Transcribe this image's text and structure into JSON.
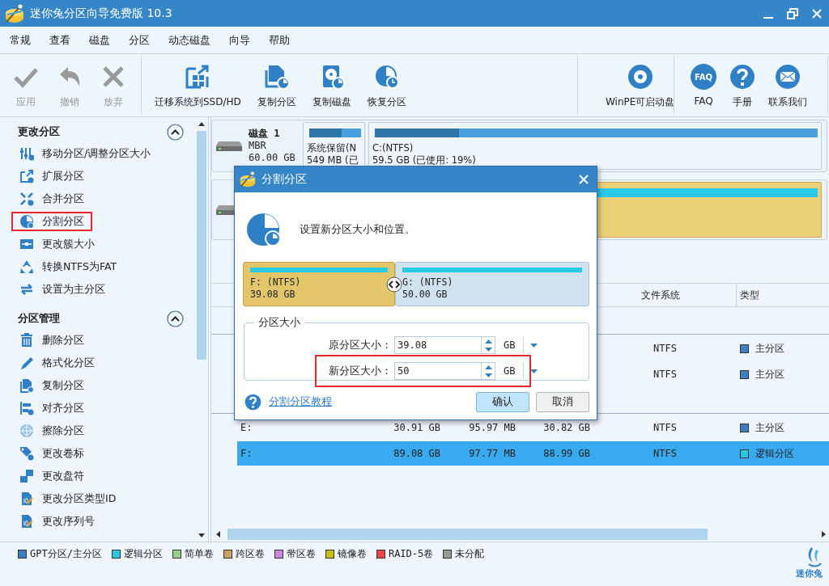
{
  "window": {
    "title": "迷你兔分区向导免费版 10.3"
  },
  "menu": [
    "常规",
    "查看",
    "磁盘",
    "分区",
    "动态磁盘",
    "向导",
    "帮助"
  ],
  "toolbar": {
    "groups": [
      {
        "buttons": [
          {
            "label": "应用",
            "disabled": true
          },
          {
            "label": "撤销",
            "disabled": true
          },
          {
            "label": "放弃",
            "disabled": true
          }
        ]
      },
      {
        "buttons": [
          {
            "label": "迁移系统到SSD/HD",
            "disabled": false
          },
          {
            "label": "复制分区",
            "disabled": false
          },
          {
            "label": "复制磁盘",
            "disabled": false
          },
          {
            "label": "恢复分区",
            "disabled": false
          }
        ]
      },
      {
        "buttons": [
          {
            "label": "WinPE可启动盘",
            "disabled": false
          }
        ]
      },
      {
        "buttons": [
          {
            "label": "FAQ",
            "badge": "FAQ",
            "disabled": false
          },
          {
            "label": "手册",
            "disabled": false
          },
          {
            "label": "联系我们",
            "disabled": false
          }
        ]
      }
    ]
  },
  "sidebar": {
    "sections": [
      {
        "title": "更改分区",
        "expanded": true,
        "items": [
          {
            "label": "移动分区/调整分区大小",
            "highlighted": false
          },
          {
            "label": "扩展分区",
            "highlighted": false
          },
          {
            "label": "合并分区",
            "highlighted": false
          },
          {
            "label": "分割分区",
            "highlighted": true
          },
          {
            "label": "更改簇大小",
            "highlighted": false
          },
          {
            "label": "转换NTFS为FAT",
            "highlighted": false
          },
          {
            "label": "设置为主分区",
            "highlighted": false
          }
        ]
      },
      {
        "title": "分区管理",
        "expanded": true,
        "items": [
          {
            "label": "删除分区",
            "highlighted": false
          },
          {
            "label": "格式化分区",
            "highlighted": false
          },
          {
            "label": "复制分区",
            "highlighted": false
          },
          {
            "label": "对齐分区",
            "highlighted": false
          },
          {
            "label": "擦除分区",
            "highlighted": false
          },
          {
            "label": "更改卷标",
            "highlighted": false
          },
          {
            "label": "更改盘符",
            "highlighted": false
          },
          {
            "label": "更改分区类型ID",
            "highlighted": false
          },
          {
            "label": "更改序列号",
            "highlighted": false
          }
        ]
      }
    ]
  },
  "disk_map": {
    "disks": [
      {
        "name": "磁盘 1",
        "scheme": "MBR",
        "size": "60.00 GB",
        "partitions": [
          {
            "kind": "primary",
            "label": "系统保留(N",
            "detail": "549 MB (已",
            "level": 0.62,
            "selected": false
          },
          {
            "kind": "primary",
            "label": "C:(NTFS)",
            "detail": "59.5 GB (已使用: 19%)",
            "level": 0.19,
            "selected": false
          }
        ]
      },
      {
        "partitions": [
          {
            "kind": "logical",
            "selected": true
          }
        ]
      }
    ]
  },
  "table": {
    "columns": [
      "文件系统",
      "类型"
    ],
    "groups": [
      {
        "rows": [
          {
            "file_system": "NTFS",
            "type": "主分区",
            "color": "#3a7fc1",
            "selected": false
          },
          {
            "file_system": "NTFS",
            "type": "主分区",
            "color": "#3a7fc1",
            "selected": false
          }
        ]
      },
      {
        "rows": [
          {
            "partition": "E:",
            "capacity": "30.91 GB",
            "used": "95.97 MB",
            "unused": "30.82 GB",
            "file_system": "NTFS",
            "type": "主分区",
            "color": "#3a7fc1",
            "selected": false
          },
          {
            "partition": "F:",
            "capacity": "89.08 GB",
            "used": "97.77 MB",
            "unused": "88.99 GB",
            "file_system": "NTFS",
            "type": "逻辑分区",
            "color": "#2ec5e0",
            "selected": true
          }
        ]
      }
    ]
  },
  "legend": [
    {
      "label": "GPT分区/主分区",
      "color": "#3a7fc1"
    },
    {
      "label": "逻辑分区",
      "color": "#2ec5e0"
    },
    {
      "label": "简单卷",
      "color": "#9bd08a"
    },
    {
      "label": "跨区卷",
      "color": "#d0a060"
    },
    {
      "label": "带区卷",
      "color": "#cc88dd"
    },
    {
      "label": "镜像卷",
      "color": "#c8c000"
    },
    {
      "label": "RAID-5卷",
      "color": "#ee4444"
    },
    {
      "label": "未分配",
      "color": "#999999"
    }
  ],
  "logo": {
    "text": "迷你兔"
  },
  "dialog": {
    "title": "分割分区",
    "message": "设置新分区大小和位置。",
    "parts": [
      {
        "kind": "logical",
        "label": "F: (NTFS)",
        "size": "39.08 GB",
        "selected": true
      },
      {
        "kind": "logical",
        "label": "G: (NTFS)",
        "size": "50.00 GB",
        "selected": false
      }
    ],
    "group_title": "分区大小",
    "fields": [
      {
        "label": "原分区大小：",
        "value": "39.08",
        "unit": "GB",
        "highlighted": false
      },
      {
        "label": "新分区大小：",
        "value": "50",
        "unit": "GB",
        "highlighted": true
      }
    ],
    "help_link": "分割分区教程",
    "buttons": [
      {
        "label": "确认",
        "default": true
      },
      {
        "label": "取消",
        "default": false
      }
    ]
  }
}
